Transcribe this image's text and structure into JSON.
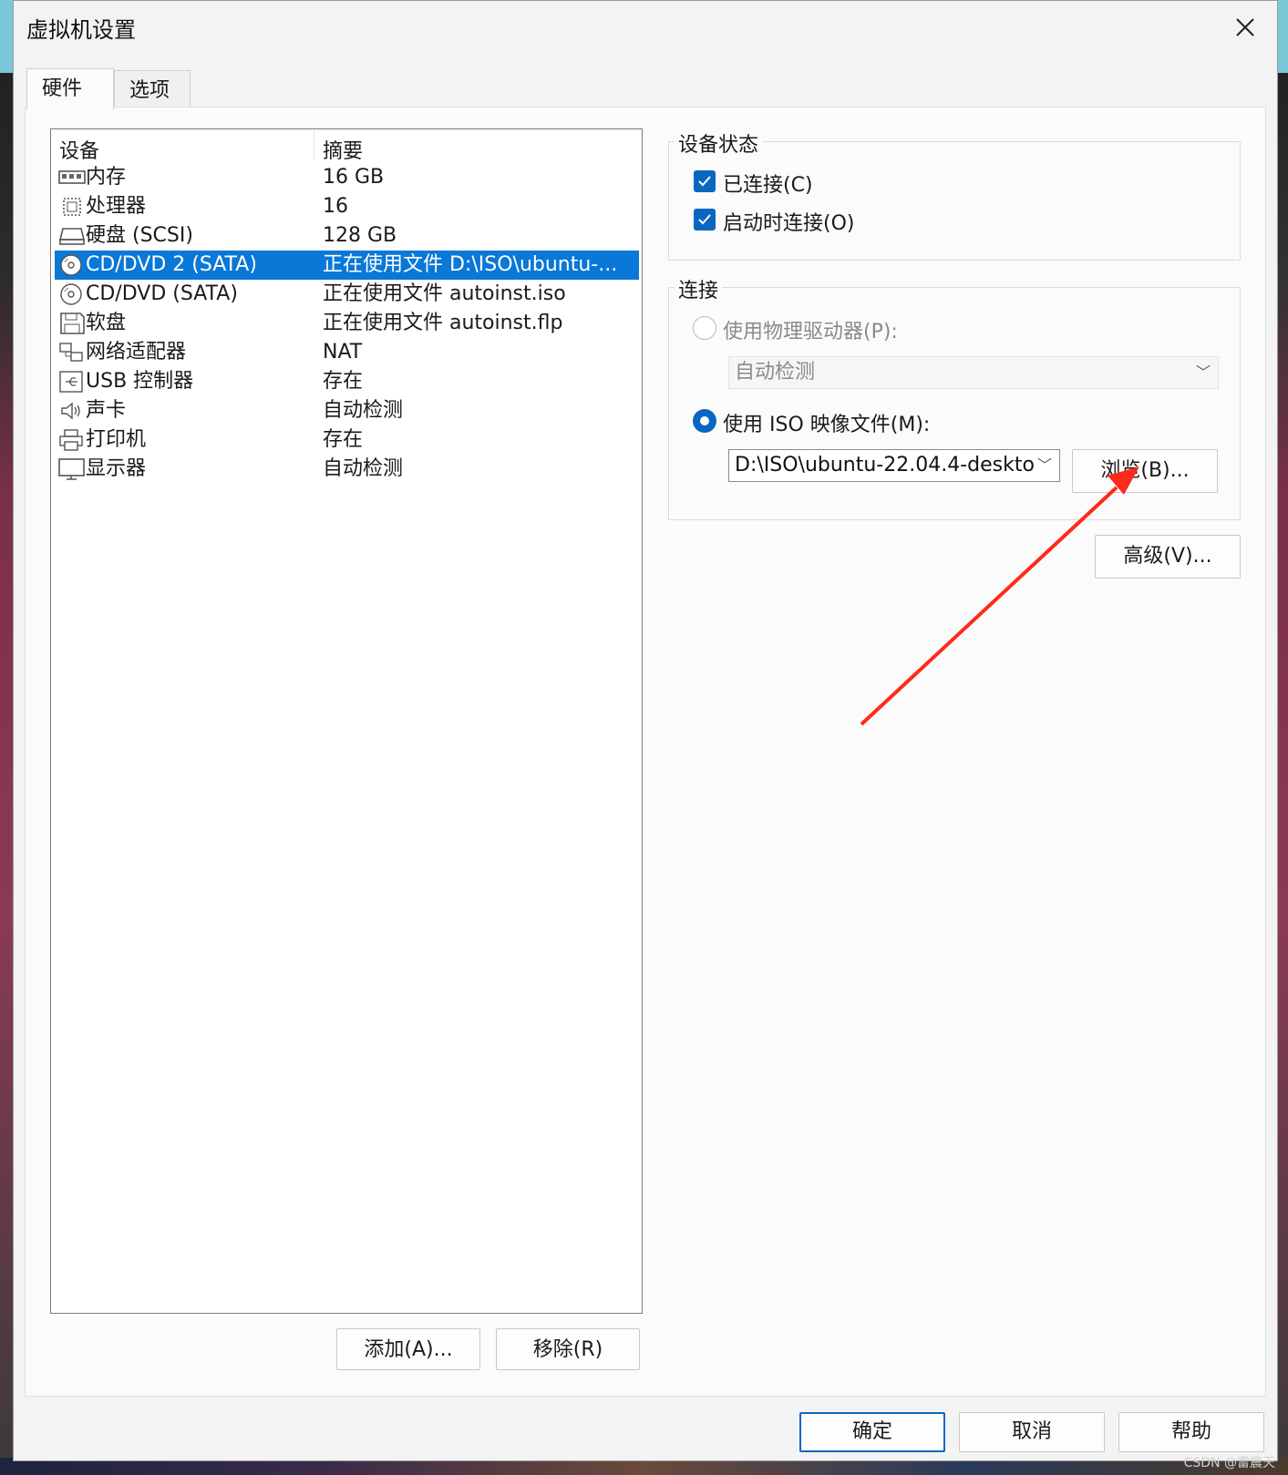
{
  "window": {
    "title": "虚拟机设置",
    "close_label": "✕"
  },
  "tabs": [
    {
      "label": "硬件"
    },
    {
      "label": "选项"
    }
  ],
  "device_list": {
    "headers": {
      "device": "设备",
      "summary": "摘要"
    },
    "rows": [
      {
        "name": "内存",
        "summary": "16 GB",
        "icon": "memory-icon"
      },
      {
        "name": "处理器",
        "summary": "16",
        "icon": "processor-icon"
      },
      {
        "name": "硬盘 (SCSI)",
        "summary": "128 GB",
        "icon": "hard-disk-icon"
      },
      {
        "name": "CD/DVD 2 (SATA)",
        "summary": "正在使用文件 D:\\ISO\\ubuntu-...",
        "icon": "cd-dvd-icon",
        "selected": true
      },
      {
        "name": "CD/DVD (SATA)",
        "summary": "正在使用文件 autoinst.iso",
        "icon": "cd-dvd-icon"
      },
      {
        "name": "软盘",
        "summary": "正在使用文件 autoinst.flp",
        "icon": "floppy-icon"
      },
      {
        "name": "网络适配器",
        "summary": "NAT",
        "icon": "network-adapter-icon"
      },
      {
        "name": "USB 控制器",
        "summary": "存在",
        "icon": "usb-icon"
      },
      {
        "name": "声卡",
        "summary": "自动检测",
        "icon": "sound-card-icon"
      },
      {
        "name": "打印机",
        "summary": "存在",
        "icon": "printer-icon"
      },
      {
        "name": "显示器",
        "summary": "自动检测",
        "icon": "display-icon"
      }
    ]
  },
  "list_buttons": {
    "add": "添加(A)...",
    "remove": "移除(R)"
  },
  "device_status": {
    "title": "设备状态",
    "connected": {
      "label": "已连接(C)",
      "checked": true
    },
    "connect_at_power_on": {
      "label": "启动时连接(O)",
      "checked": true
    }
  },
  "connection": {
    "title": "连接",
    "physical_drive": {
      "label": "使用物理驱动器(P):",
      "selected": false,
      "value": "自动检测"
    },
    "iso_image": {
      "label": "使用 ISO 映像文件(M):",
      "selected": true,
      "value": "D:\\ISO\\ubuntu-22.04.4-deskto"
    },
    "browse_button": "浏览(B)...",
    "advanced_button": "高级(V)..."
  },
  "footer": {
    "ok": "确定",
    "cancel": "取消",
    "help": "帮助"
  },
  "watermark": "CSDN @雷震天",
  "colors": {
    "accent": "#0a67c1",
    "selection": "#0a78d7",
    "annotation_arrow": "#ff2a1a"
  }
}
